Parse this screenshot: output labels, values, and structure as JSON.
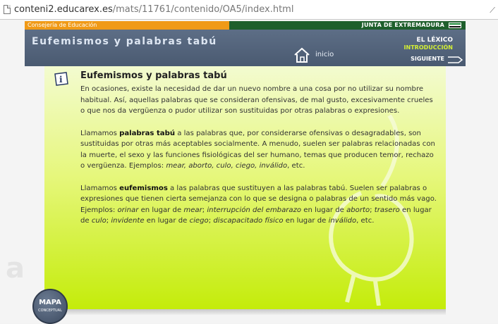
{
  "browser": {
    "url_prefix": "conteni2.educarex.es",
    "url_rest": "/mats/11761/contenido/OA5/index.html"
  },
  "topbar": {
    "consejeria": "Consejería de Educación",
    "junta": "JUNTA DE EXTREMADURA"
  },
  "header": {
    "title": "Eufemismos y palabras tabú",
    "home_label": "inicio",
    "section": "EL LÉXICO",
    "subsection": "INTRODUCCIÓN",
    "next_label": "SIGUIENTE"
  },
  "content": {
    "title": "Eufemismos y palabras tabú",
    "p1": "En ocasiones, existe la necesidad de dar un nuevo nombre a una cosa por no utilizar su nombre habitual. Así, aquellas palabras que se consideran ofensivas, de mal gusto, excesivamente crueles o que nos da vergüenza o pudor utilizar son sustituidas por otras palabras o expresiones.",
    "p2_a": "Llamamos ",
    "p2_b": "palabras tabú",
    "p2_c": " a las palabras que, por considerarse ofensivas o desagradables, son sustituidas por otras más aceptables socialmente. A menudo, suelen ser palabras relacionadas con la muerte, el sexo y las funciones fisiológicas del ser humano, temas que producen temor, rechazo o vergüenza. Ejemplos: ",
    "p2_d": "mear, aborto, culo, ciego, inválido",
    "p2_e": ", etc.",
    "p3_a": "Llamamos ",
    "p3_b": "eufemismos",
    "p3_c": " a las palabras que sustituyen a las palabras tabú. Suelen ser palabras o expresiones que tienen cierta semejanza con lo que se designa o palabras de un sentido más vago. Ejemplos: ",
    "p3_d": "orinar",
    "p3_e": " en lugar de ",
    "p3_f": "mear",
    "p3_g": "; ",
    "p3_h": "interrupción del embarazo",
    "p3_i": " en lugar de ",
    "p3_j": "aborto",
    "p3_k": "; ",
    "p3_l": "trasero",
    "p3_m": " en lugar de ",
    "p3_n": "culo",
    "p3_o": "; ",
    "p3_p": "invidente",
    "p3_q": " en lugar de ",
    "p3_r": "ciego",
    "p3_s": "; ",
    "p3_t": "discapacitado físico",
    "p3_u": " en lugar de ",
    "p3_v": "inválido",
    "p3_w": ", etc."
  },
  "mapa": {
    "label": "MAPA",
    "sub": "CONCEPTUAL"
  }
}
